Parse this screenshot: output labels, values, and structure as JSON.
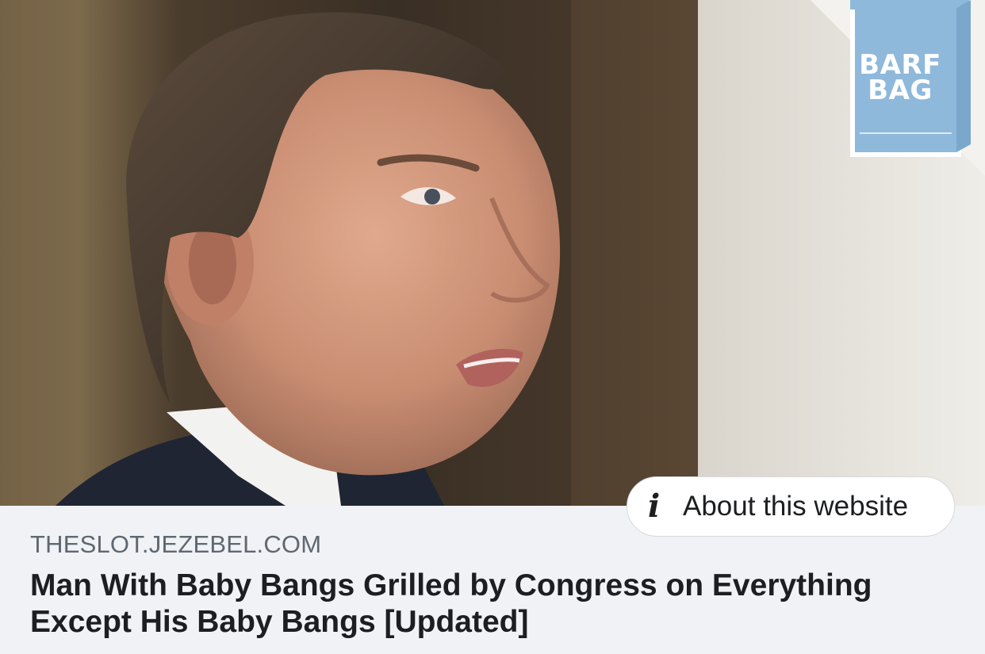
{
  "badge": {
    "line1": "BARF",
    "line2": "BAG",
    "color": "#8fb9db"
  },
  "link_preview": {
    "domain": "THESLOT.JEZEBEL.COM",
    "headline": "Man With Baby Bangs Grilled by Congress on Everything Except His Baby Bangs [Updated]",
    "about_button_label": "About this website",
    "about_icon": "info-icon"
  },
  "colors": {
    "background": "#f0f2f5",
    "domain_text": "#606770",
    "headline_text": "#1c1e21"
  }
}
